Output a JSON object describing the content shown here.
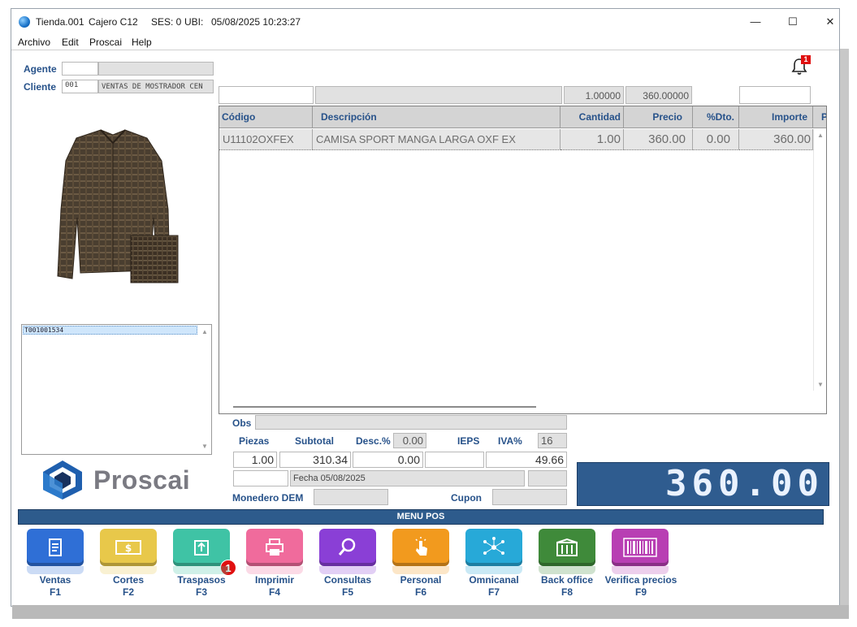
{
  "titlebar": {
    "store": "Tienda.001",
    "cashier": "Cajero C12",
    "session": "SES: 0",
    "ubi": "UBI:",
    "datetime": "05/08/2025 10:23:27",
    "minimize": "—",
    "maximize": "☐",
    "close": "✕"
  },
  "menubar": [
    "Archivo",
    "Edit",
    "Proscai",
    "Help"
  ],
  "notifications": {
    "count": "1"
  },
  "agent": {
    "label": "Agente",
    "code": "",
    "name": ""
  },
  "client": {
    "label": "Cliente",
    "code": "001",
    "name": "VENTAS DE MOSTRADOR CEN"
  },
  "entry": {
    "code": "",
    "description": "",
    "quantity": "1.00000",
    "price": "360.00000",
    "extra": ""
  },
  "grid": {
    "headers": [
      "Código",
      "Descripción",
      "Cantidad",
      "Precio",
      "%Dto.",
      "Importe",
      "P"
    ],
    "rows": [
      {
        "code": "U11102OXFEX",
        "description": "CAMISA SPORT MANGA LARGA OXF EX",
        "quantity": "1.00",
        "price": "360.00",
        "discount": "0.00",
        "amount": "360.00"
      }
    ]
  },
  "ticket_list": {
    "items": [
      "T001001534"
    ]
  },
  "brand": {
    "name": "Proscai"
  },
  "summary": {
    "obs_label": "Obs",
    "pieces_label": "Piezas",
    "subtotal_label": "Subtotal",
    "desc_label": "Desc.%",
    "desc_pct": "0.00",
    "ieps_label": "IEPS",
    "iva_label": "IVA%",
    "iva_pct": "16",
    "pieces": "1.00",
    "subtotal": "310.34",
    "discount": "0.00",
    "ieps": "",
    "iva": "49.66",
    "date_text": "Fecha 05/08/2025",
    "monedero_label": "Monedero DEM",
    "cupon_label": "Cupon"
  },
  "total": "360.00",
  "menu_pos": {
    "title": "MENU POS",
    "traspasos_badge": "1",
    "items": [
      {
        "label": "Ventas",
        "key": "F1",
        "color": "#2f6fd6",
        "icon": "receipt-icon"
      },
      {
        "label": "Cortes",
        "key": "F2",
        "color": "#e8c84a",
        "icon": "cash-icon"
      },
      {
        "label": "Traspasos",
        "key": "F3",
        "color": "#3fc3a5",
        "icon": "upload-box-icon"
      },
      {
        "label": "Imprimir",
        "key": "F4",
        "color": "#f06b9c",
        "icon": "printer-icon"
      },
      {
        "label": "Consultas",
        "key": "F5",
        "color": "#8a3fd6",
        "icon": "search-icon"
      },
      {
        "label": "Personal",
        "key": "F6",
        "color": "#f29a1e",
        "icon": "hand-pointer-icon"
      },
      {
        "label": "Omnicanal",
        "key": "F7",
        "color": "#27a9d8",
        "icon": "network-icon"
      },
      {
        "label": "Back office",
        "key": "F8",
        "color": "#3f8a3a",
        "icon": "building-icon"
      },
      {
        "label": "Verifica precios",
        "key": "F9",
        "color": "#b83fb3",
        "icon": "barcode-icon"
      }
    ]
  }
}
